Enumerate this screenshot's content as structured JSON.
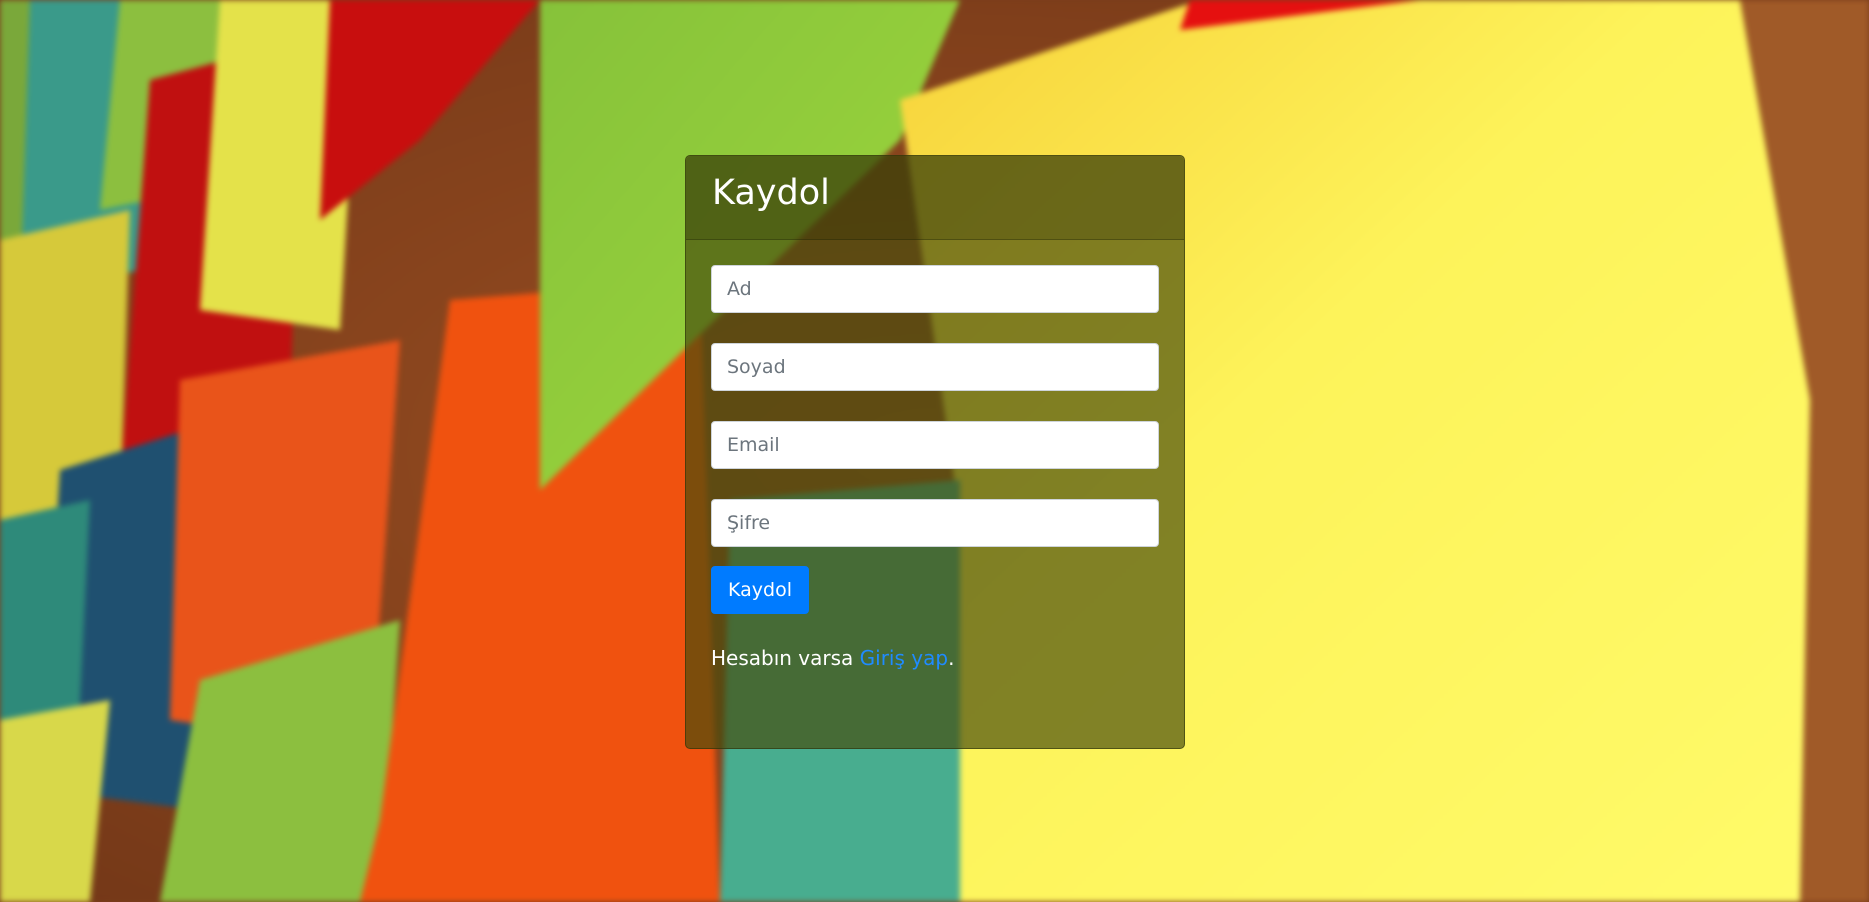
{
  "register": {
    "title": "Kaydol",
    "fields": {
      "first_name_placeholder": "Ad",
      "last_name_placeholder": "Soyad",
      "email_placeholder": "Email",
      "password_placeholder": "Şifre"
    },
    "submit_label": "Kaydol",
    "footer": {
      "prefix": "Hesabın varsa ",
      "link_label": "Giriş yap",
      "suffix": "."
    }
  },
  "colors": {
    "primary_button": "#007bff",
    "link": "#1f8bff",
    "card_overlay": "rgba(70,75,12,0.68)"
  }
}
